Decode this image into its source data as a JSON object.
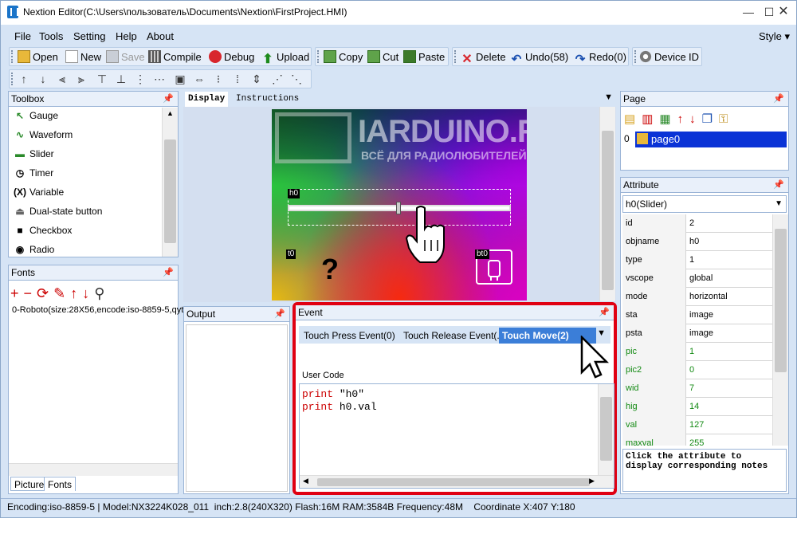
{
  "window": {
    "title": "Nextion Editor(C:\\Users\\пользователь\\Documents\\Nextion\\FirstProject.HMI)"
  },
  "menu": {
    "file": "File",
    "tools": "Tools",
    "setting": "Setting",
    "help": "Help",
    "about": "About",
    "style": "Style"
  },
  "toolbar": {
    "open": "Open",
    "new": "New",
    "save": "Save",
    "compile": "Compile",
    "debug": "Debug",
    "upload": "Upload",
    "copy": "Copy",
    "cut": "Cut",
    "paste": "Paste",
    "delete": "Delete",
    "undo": "Undo(58)",
    "redo": "Redo(0)",
    "device": "Device",
    "id": "ID"
  },
  "toolbox": {
    "title": "Toolbox",
    "items": [
      "Gauge",
      "Waveform",
      "Slider",
      "Timer",
      "Variable",
      "Dual-state button",
      "Checkbox",
      "Radio"
    ]
  },
  "fonts": {
    "title": "Fonts",
    "entry": "0-Roboto(size:28X56,encode:iso-8859-5,qyt",
    "tab_picture": "Picture",
    "tab_fonts": "Fonts"
  },
  "display": {
    "tab_display": "Display",
    "tab_instructions": "Instructions",
    "logo": "IARDUINO.RU",
    "logo_sub": "ВСЁ ДЛЯ РАДИОЛЮБИТЕЛЕЙ",
    "labels": {
      "h0": "h0",
      "t0": "t0",
      "bt0": "bt0"
    },
    "question": "?",
    "slider_position": 0.5
  },
  "output": {
    "title": "Output"
  },
  "event": {
    "title": "Event",
    "tabs": [
      "Touch Press Event(0)",
      "Touch Release Event(...",
      "Touch Move(2)"
    ],
    "user_code": "User Code",
    "code_lines": [
      {
        "kw": "print",
        "arg": " \"h0\""
      },
      {
        "kw": "print",
        "arg": " h0.val"
      }
    ]
  },
  "page": {
    "title": "Page",
    "index": "0",
    "name": "page0"
  },
  "attribute": {
    "title": "Attribute",
    "selected": "h0(Slider)",
    "rows": [
      {
        "k": "id",
        "v": "2",
        "color": "#000"
      },
      {
        "k": "objname",
        "v": "h0",
        "color": "#000"
      },
      {
        "k": "type",
        "v": "1",
        "color": "#000"
      },
      {
        "k": "vscope",
        "v": "global",
        "color": "#000"
      },
      {
        "k": "mode",
        "v": "horizontal",
        "color": "#000"
      },
      {
        "k": "sta",
        "v": "image",
        "color": "#000"
      },
      {
        "k": "psta",
        "v": "image",
        "color": "#000"
      },
      {
        "k": "pic",
        "v": "1",
        "color": "#138a13"
      },
      {
        "k": "pic2",
        "v": "0",
        "color": "#138a13"
      },
      {
        "k": "wid",
        "v": "7",
        "color": "#138a13"
      },
      {
        "k": "hig",
        "v": "14",
        "color": "#138a13"
      },
      {
        "k": "val",
        "v": "127",
        "color": "#138a13"
      },
      {
        "k": "maxval",
        "v": "255",
        "color": "#138a13"
      }
    ],
    "note": "Click the attribute to display corresponding notes"
  },
  "status": {
    "encoding": "Encoding:iso-8859-5",
    "model": "Model:NX3224K028_011",
    "inch": "inch:2.8(240X320)",
    "flash": "Flash:16M",
    "ram": "RAM:3584B",
    "freq": "Frequency:48M",
    "coord": "Coordinate X:407  Y:180"
  }
}
